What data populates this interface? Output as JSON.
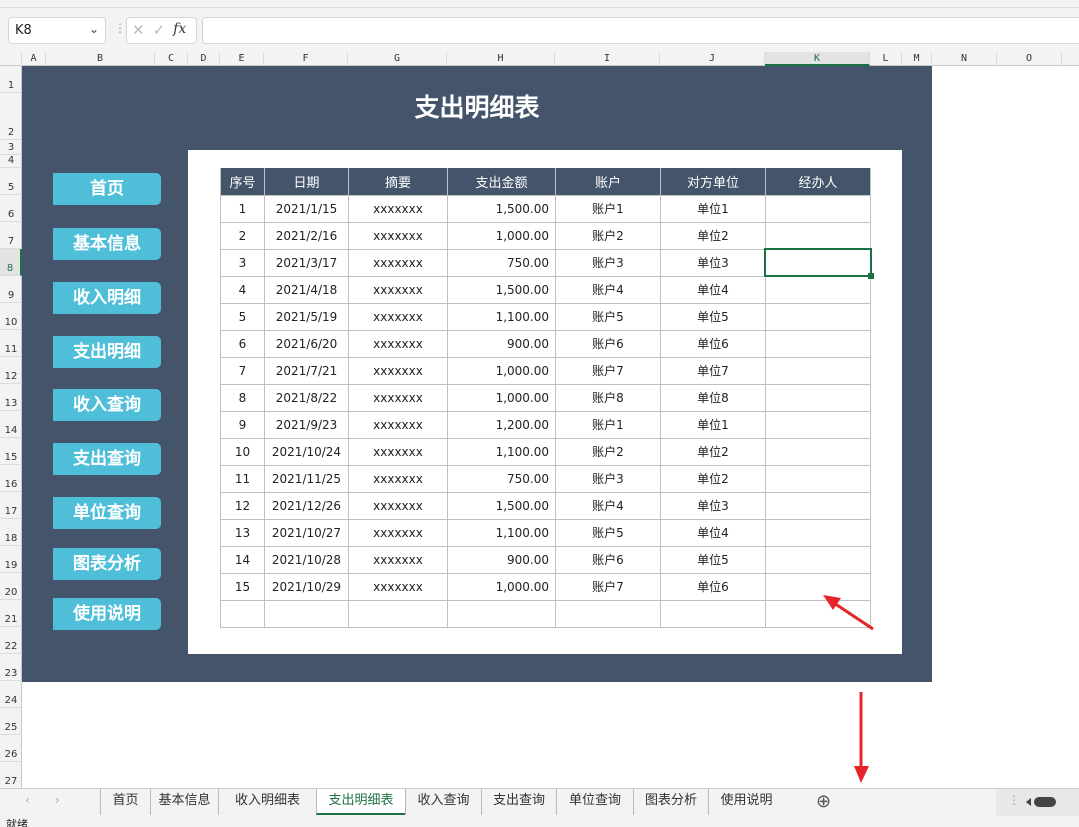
{
  "formula_bar": {
    "name_box": "K8",
    "cancel_icon": "✕",
    "confirm_icon": "✓",
    "fx_label": "fx",
    "formula": ""
  },
  "columns": [
    "A",
    "B",
    "C",
    "D",
    "E",
    "F",
    "G",
    "H",
    "I",
    "J",
    "K",
    "L",
    "M",
    "N",
    "O"
  ],
  "selected_column": "K",
  "rows": [
    "1",
    "2",
    "3",
    "4",
    "5",
    "6",
    "7",
    "8",
    "9",
    "10",
    "11",
    "12",
    "13",
    "14",
    "15",
    "16",
    "17",
    "18",
    "19",
    "20",
    "21",
    "22",
    "23",
    "24",
    "25",
    "26",
    "27"
  ],
  "selected_row": "8",
  "sheet_title": "支出明细表",
  "nav_buttons": [
    "首页",
    "基本信息",
    "收入明细",
    "支出明细",
    "收入查询",
    "支出查询",
    "单位查询",
    "图表分析",
    "使用说明"
  ],
  "table": {
    "headers": [
      "序号",
      "日期",
      "摘要",
      "支出金额",
      "账户",
      "对方单位",
      "经办人"
    ],
    "rows": [
      [
        "1",
        "2021/1/15",
        "xxxxxxx",
        "1,500.00",
        "账户1",
        "单位1",
        ""
      ],
      [
        "2",
        "2021/2/16",
        "xxxxxxx",
        "1,000.00",
        "账户2",
        "单位2",
        ""
      ],
      [
        "3",
        "2021/3/17",
        "xxxxxxx",
        "750.00",
        "账户3",
        "单位3",
        ""
      ],
      [
        "4",
        "2021/4/18",
        "xxxxxxx",
        "1,500.00",
        "账户4",
        "单位4",
        ""
      ],
      [
        "5",
        "2021/5/19",
        "xxxxxxx",
        "1,100.00",
        "账户5",
        "单位5",
        ""
      ],
      [
        "6",
        "2021/6/20",
        "xxxxxxx",
        "900.00",
        "账户6",
        "单位6",
        ""
      ],
      [
        "7",
        "2021/7/21",
        "xxxxxxx",
        "1,000.00",
        "账户7",
        "单位7",
        ""
      ],
      [
        "8",
        "2021/8/22",
        "xxxxxxx",
        "1,000.00",
        "账户8",
        "单位8",
        ""
      ],
      [
        "9",
        "2021/9/23",
        "xxxxxxx",
        "1,200.00",
        "账户1",
        "单位1",
        ""
      ],
      [
        "10",
        "2021/10/24",
        "xxxxxxx",
        "1,100.00",
        "账户2",
        "单位2",
        ""
      ],
      [
        "11",
        "2021/11/25",
        "xxxxxxx",
        "750.00",
        "账户3",
        "单位2",
        ""
      ],
      [
        "12",
        "2021/12/26",
        "xxxxxxx",
        "1,500.00",
        "账户4",
        "单位3",
        ""
      ],
      [
        "13",
        "2021/10/27",
        "xxxxxxx",
        "1,100.00",
        "账户5",
        "单位4",
        ""
      ],
      [
        "14",
        "2021/10/28",
        "xxxxxxx",
        "900.00",
        "账户6",
        "单位5",
        ""
      ],
      [
        "15",
        "2021/10/29",
        "xxxxxxx",
        "1,000.00",
        "账户7",
        "单位6",
        ""
      ],
      [
        "",
        "",
        "",
        "",
        "",
        "",
        ""
      ]
    ]
  },
  "sheet_tabs": [
    "首页",
    "基本信息",
    "收入明细表",
    "支出明细表",
    "收入查询",
    "支出查询",
    "单位查询",
    "图表分析",
    "使用说明"
  ],
  "active_tab": "支出明细表",
  "add_sheet_icon": "⊕",
  "status": "就绪",
  "colors": {
    "panel": "#44546a",
    "button": "#4fbfd9",
    "accent": "#1e7145",
    "annotation_arrow": "#e8242b"
  }
}
